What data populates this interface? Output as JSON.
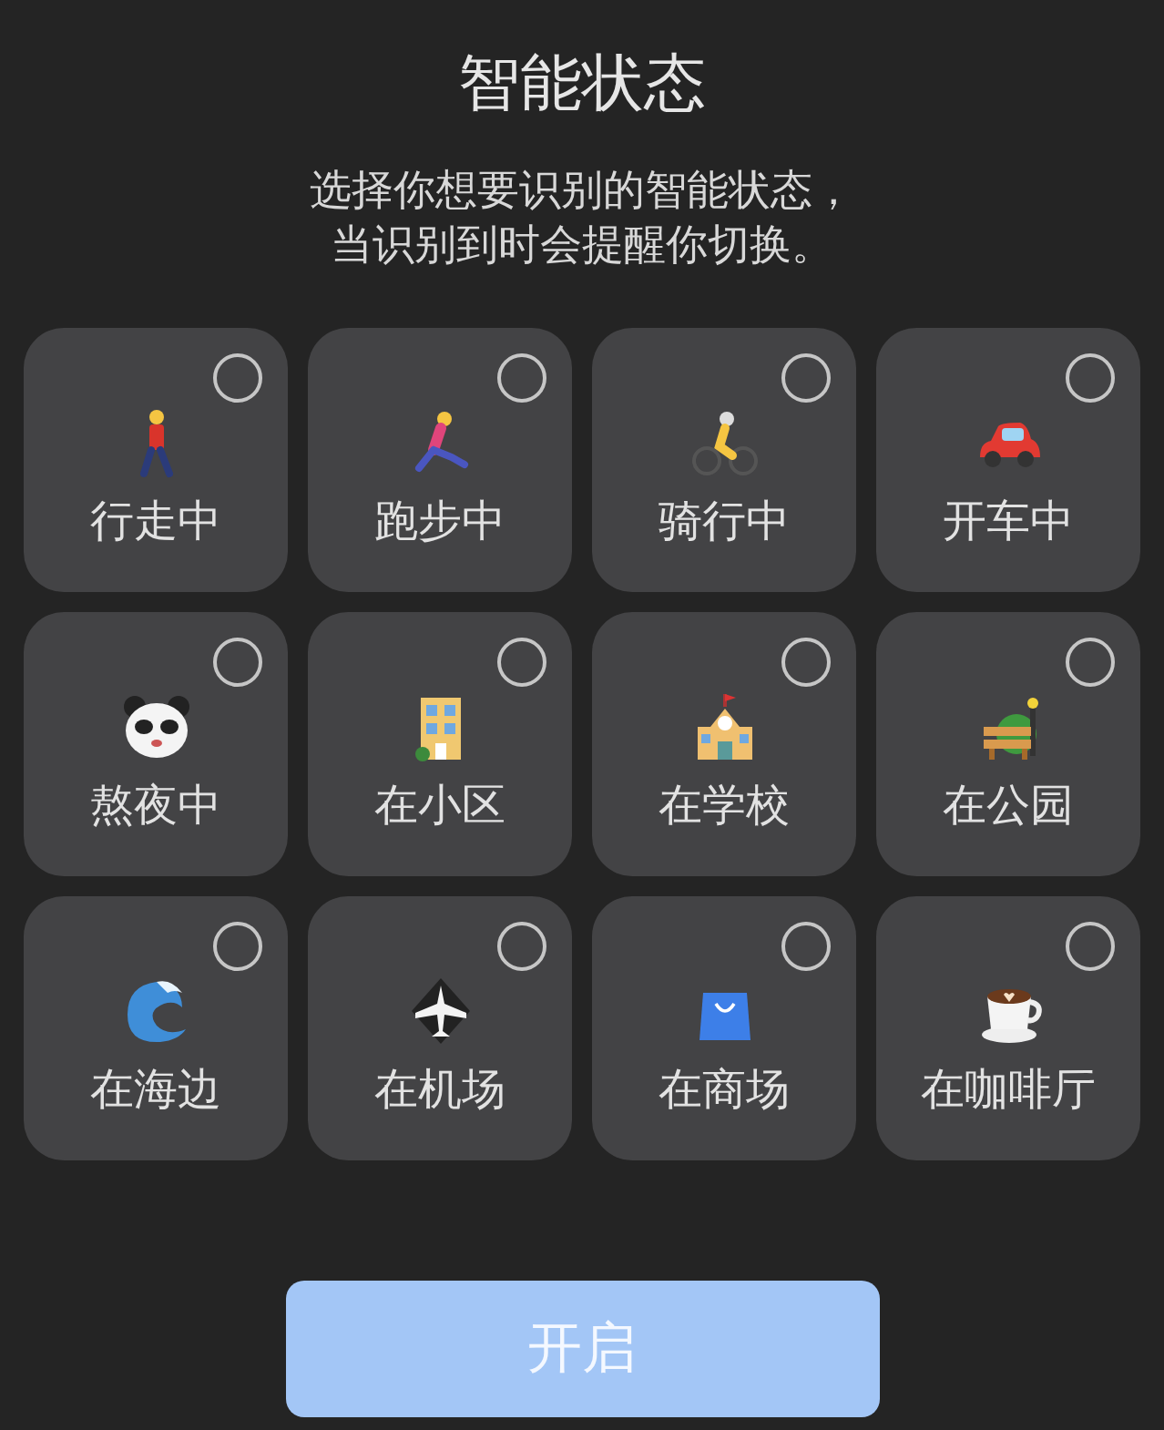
{
  "title": "智能状态",
  "description": [
    "选择你想要识别的智能状态，",
    "当识别到时会提醒你切换。"
  ],
  "states": [
    {
      "label": "行走中",
      "selected": false
    },
    {
      "label": "跑步中",
      "selected": false
    },
    {
      "label": "骑行中",
      "selected": false
    },
    {
      "label": "开车中",
      "selected": false
    },
    {
      "label": "熬夜中",
      "selected": false
    },
    {
      "label": "在小区",
      "selected": false
    },
    {
      "label": "在学校",
      "selected": false
    },
    {
      "label": "在公园",
      "selected": false
    },
    {
      "label": "在海边",
      "selected": false
    },
    {
      "label": "在机场",
      "selected": false
    },
    {
      "label": "在商场",
      "selected": false
    },
    {
      "label": "在咖啡厅",
      "selected": false
    }
  ],
  "button": {
    "label": "开启",
    "disabled": true
  }
}
